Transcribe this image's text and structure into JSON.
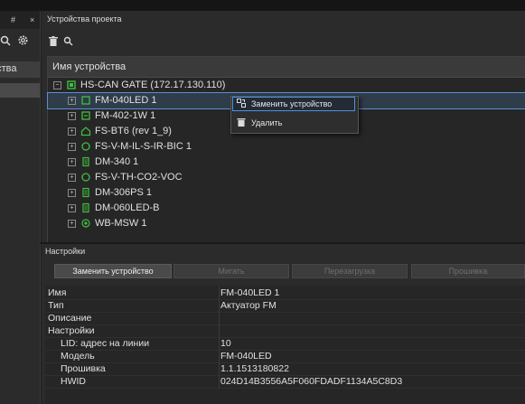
{
  "left_sidebar": {
    "tab_label": "йства",
    "header_buttons": [
      "#",
      "×"
    ]
  },
  "devices_panel": {
    "title": "Устройства проекта",
    "column_header": "Имя устройства",
    "gateway": "HS-CAN GATE (172.17.130.110)",
    "devices": [
      {
        "label": "FM-040LED 1",
        "icon": "module-icon",
        "selected": true
      },
      {
        "label": "FM-402-1W 1",
        "icon": "module-icon"
      },
      {
        "label": "FS-BT6 (rev 1_9)",
        "icon": "house-icon"
      },
      {
        "label": "FS-V-M-IL-S-IR-BIC 1",
        "icon": "sensor-icon"
      },
      {
        "label": "DM-340 1",
        "icon": "dimmer-icon"
      },
      {
        "label": "FS-V-TH-CO2-VOC",
        "icon": "sensor-icon"
      },
      {
        "label": "DM-306PS 1",
        "icon": "dimmer-icon"
      },
      {
        "label": "DM-060LED-B",
        "icon": "dimmer-icon"
      },
      {
        "label": "WB-MSW 1",
        "icon": "target-icon"
      }
    ]
  },
  "context_menu": {
    "replace": "Заменить устройство",
    "delete": "Удалить"
  },
  "settings_panel": {
    "title": "Настройки",
    "buttons": {
      "replace": "Заменить устройство",
      "blink": "Мигать",
      "reboot": "Перезагрузка",
      "firmware": "Прошивка"
    },
    "properties": {
      "name_key": "Имя",
      "name_value": "FM-040LED 1",
      "type_key": "Тип",
      "type_value": "Актуатор FM",
      "desc_key": "Описание",
      "desc_value": "",
      "settings_key": "Настройки",
      "lid_key": "LID: адрес на линии",
      "lid_value": "10",
      "model_key": "Модель",
      "model_value": "FM-040LED",
      "fw_key": "Прошивка",
      "fw_value": "1.1.1513180822",
      "hwid_key": "HWID",
      "hwid_value": "024D14B3556A5F060FDADF1134A5C8D3"
    }
  },
  "colors": {
    "accent": "#4f8fe0",
    "tree_icon_green": "#3fbf3f",
    "background": "#2b2b2b"
  }
}
